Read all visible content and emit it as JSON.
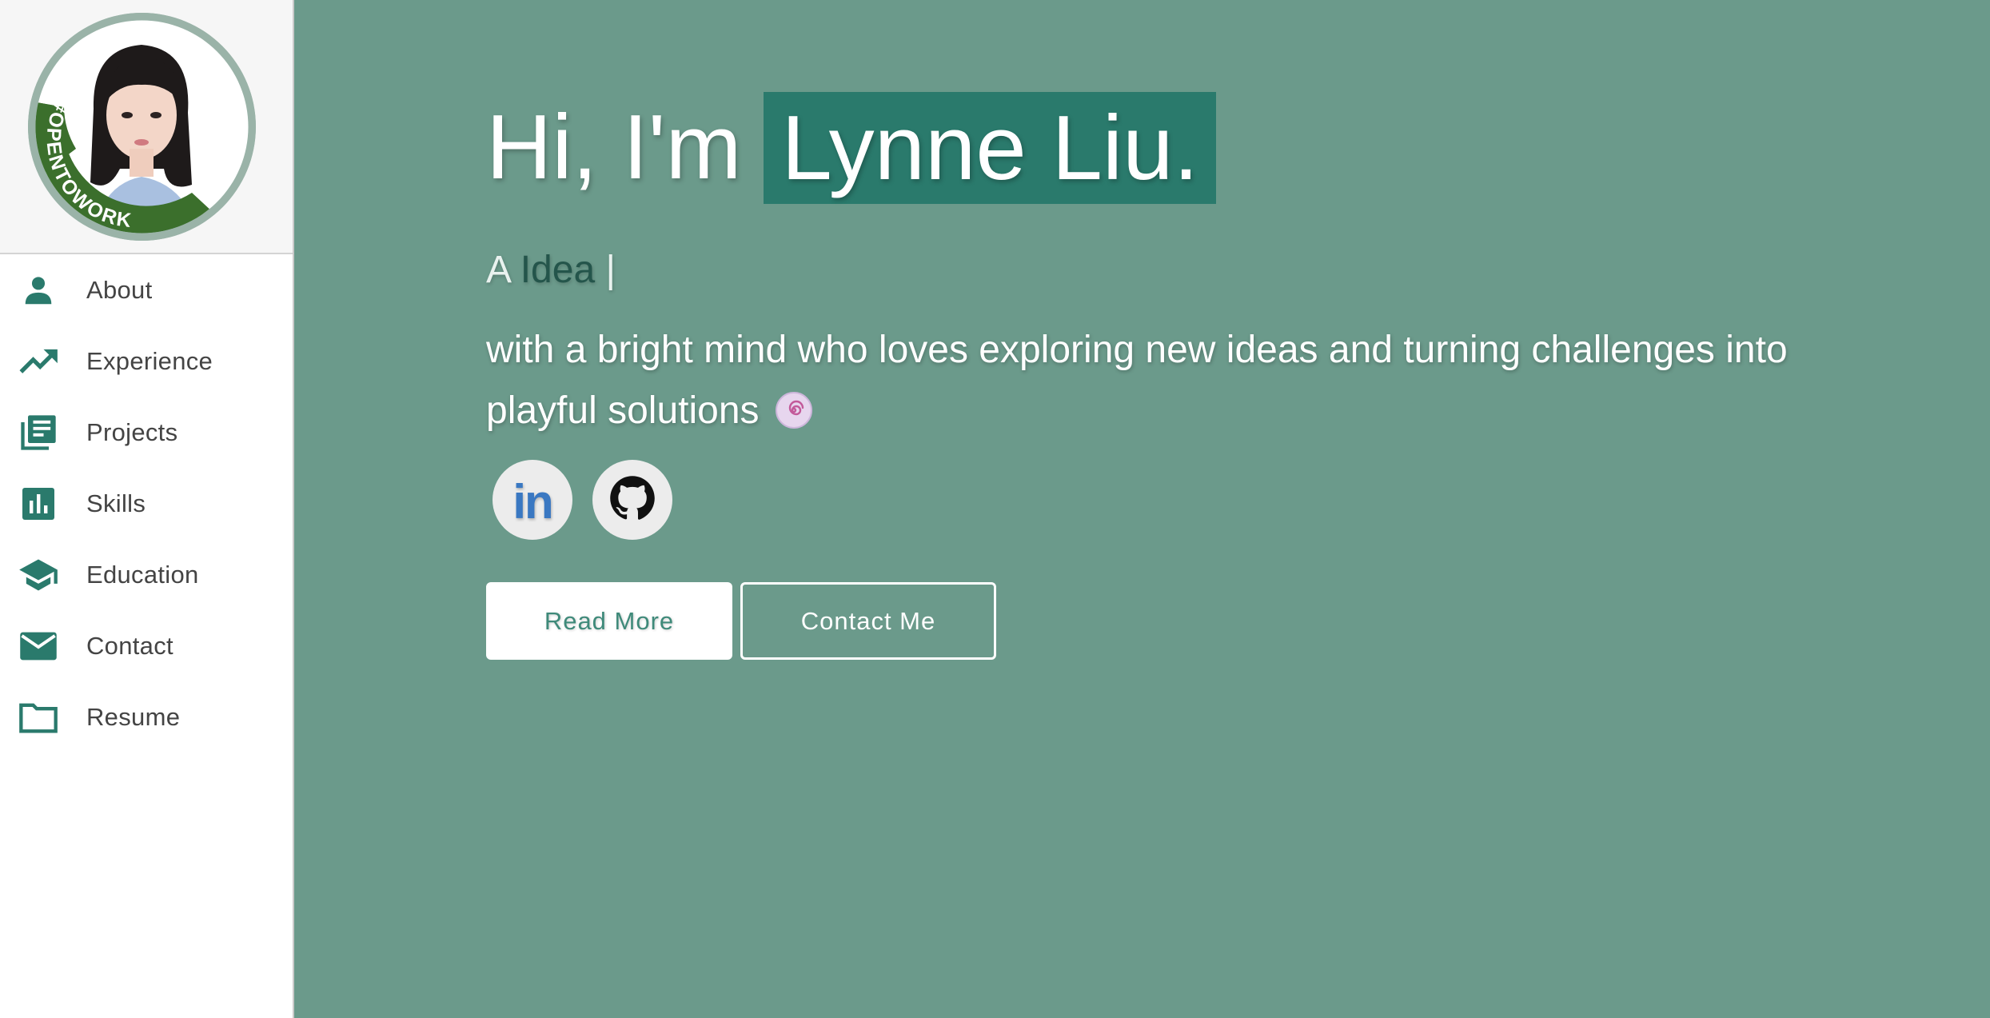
{
  "sidebar": {
    "avatar_badge": "#OPENTOWORK",
    "items": [
      {
        "label": "About",
        "icon": "person-icon"
      },
      {
        "label": "Experience",
        "icon": "trending-up-icon"
      },
      {
        "label": "Projects",
        "icon": "library-books-icon"
      },
      {
        "label": "Skills",
        "icon": "bar-chart-icon"
      },
      {
        "label": "Education",
        "icon": "school-icon"
      },
      {
        "label": "Contact",
        "icon": "mail-icon"
      },
      {
        "label": "Resume",
        "icon": "folder-icon"
      }
    ]
  },
  "hero": {
    "greeting": "Hi, I'm",
    "name": "Lynne Liu.",
    "typed_prefix": "A",
    "typed_word": "Idea",
    "typed_cursor": "|",
    "tagline": "with a bright mind who loves exploring new ideas and turning challenges into playful solutions",
    "tagline_emoji": "swirl-candy-emoji"
  },
  "social": {
    "linkedin_text": "in",
    "linkedin_icon": "linkedin-icon",
    "github_icon": "github-icon"
  },
  "buttons": {
    "read_more": "Read More",
    "contact_me": "Contact Me"
  },
  "colors": {
    "accent": "#2a7a6c",
    "background": "#6b9a8b",
    "sidebar_icon": "#2a7a6c"
  }
}
